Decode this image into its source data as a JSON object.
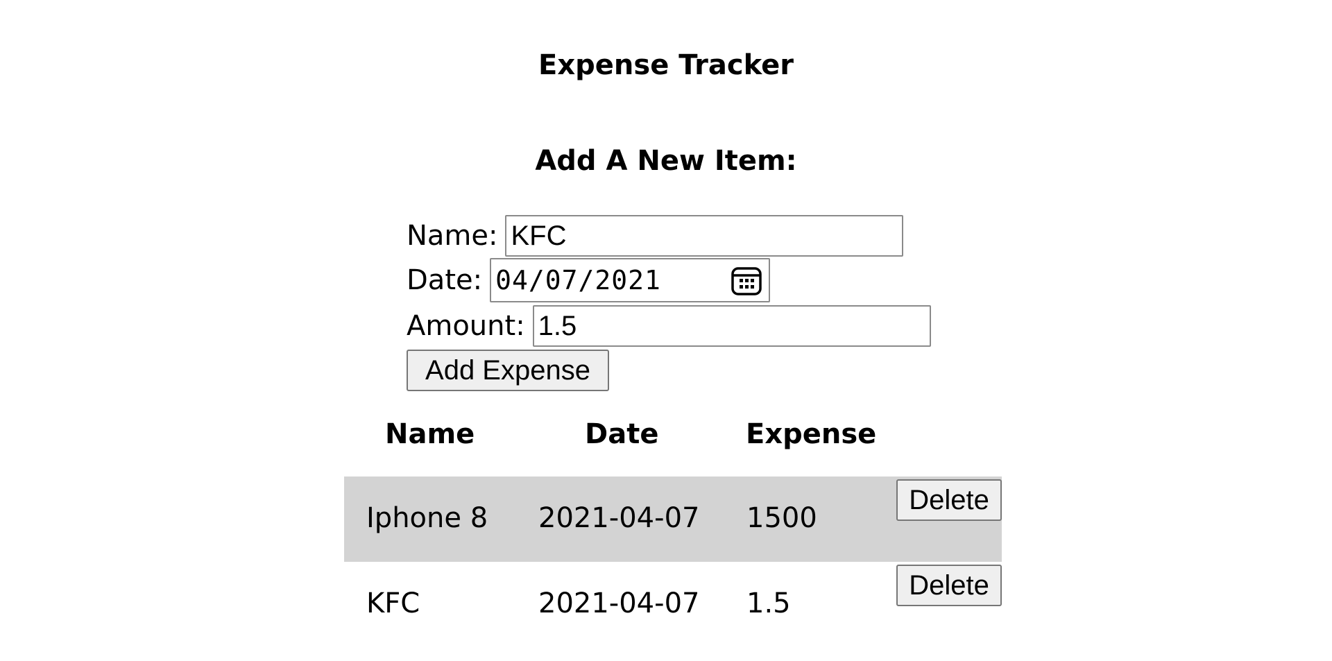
{
  "app": {
    "title": "Expense Tracker"
  },
  "form": {
    "heading": "Add A New Item:",
    "name_label": "Name:",
    "name_value": "KFC",
    "date_label": "Date:",
    "date_value": "04/07/2021",
    "amount_label": "Amount:",
    "amount_value": "1.5",
    "submit_label": "Add Expense"
  },
  "table": {
    "columns": [
      "Name",
      "Date",
      "Expense"
    ],
    "rows": [
      {
        "name": "Iphone 8",
        "date": "2021-04-07",
        "expense": "1500",
        "action": "Delete"
      },
      {
        "name": "KFC",
        "date": "2021-04-07",
        "expense": "1.5",
        "action": "Delete"
      }
    ]
  },
  "colors": {
    "row_highlight": "#d3d3d3",
    "button_bg": "#efefef",
    "input_border": "#8a8a8a"
  },
  "icons": {
    "date_picker": "calendar-icon"
  }
}
